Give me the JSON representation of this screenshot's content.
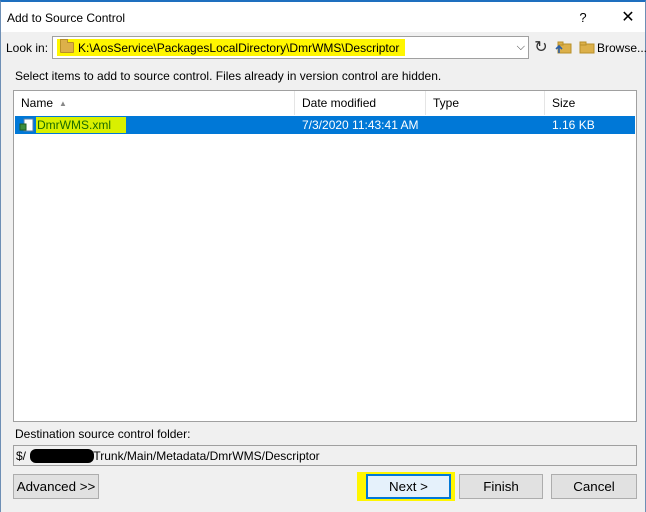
{
  "window": {
    "title": "Add to Source Control",
    "help_label": "?",
    "close_label": "✕"
  },
  "lookin": {
    "label": "Look in:",
    "path": "K:\\AosService\\PackagesLocalDirectory\\DmrWMS\\Descriptor",
    "browse_label": "Browse..."
  },
  "instruction": "Select items to add to source control. Files already in version control are hidden.",
  "filelist": {
    "columns": [
      "Name",
      "Date modified",
      "Type",
      "Size"
    ],
    "rows": [
      {
        "name": "DmrWMS.xml",
        "date": "7/3/2020 11:43:41 AM",
        "type": "",
        "size": "1.16 KB",
        "selected": true
      }
    ]
  },
  "destination": {
    "label": "Destination source control folder:",
    "prefix": "$/",
    "path_suffix": "/Trunk/Main/Metadata/DmrWMS/Descriptor"
  },
  "buttons": {
    "advanced": "Advanced >>",
    "next": "Next >",
    "finish": "Finish",
    "cancel": "Cancel"
  },
  "colors": {
    "selection": "#0078d7",
    "highlight": "#fff600"
  },
  "icons": {
    "lookin": "folder-icon",
    "refresh": "refresh-icon",
    "up": "up-folder-icon",
    "browse": "browse-folder-icon",
    "file": "xml-file-icon"
  }
}
